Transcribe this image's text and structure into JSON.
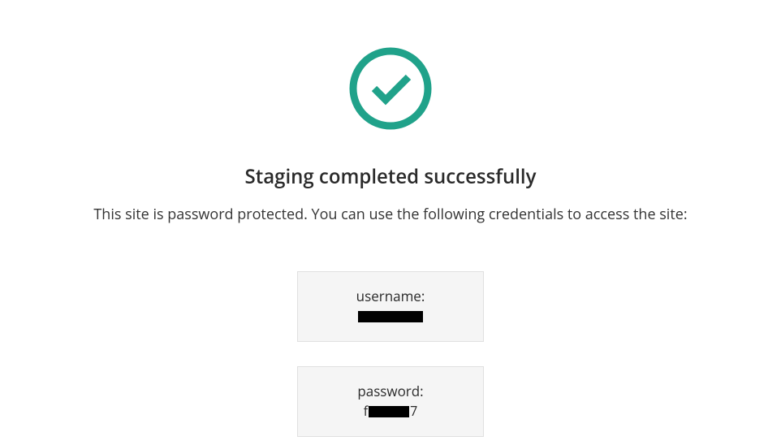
{
  "icon": {
    "name": "check-circle-icon",
    "color": "#20a28a"
  },
  "title": "Staging completed successfully",
  "description": "This site is password protected. You can use the following credentials to access the site:",
  "credentials": {
    "username": {
      "label": "username:",
      "value_redacted": true
    },
    "password": {
      "label": "password:",
      "value_prefix": "f",
      "value_suffix": "7",
      "value_redacted": true
    }
  }
}
